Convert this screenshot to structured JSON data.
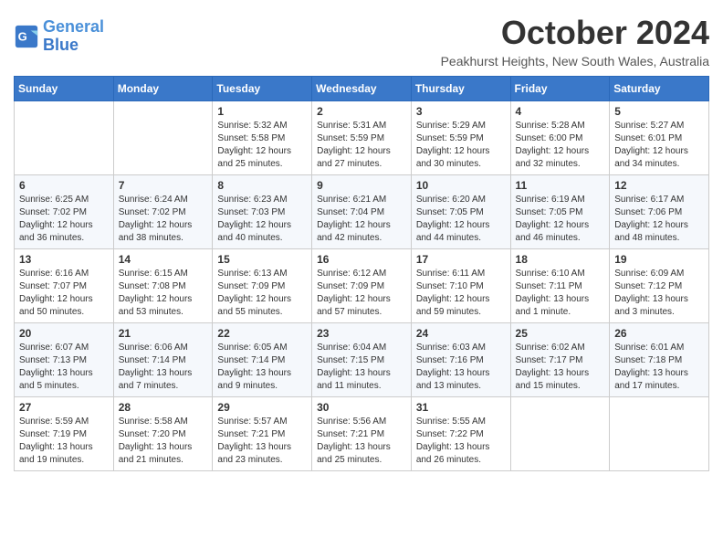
{
  "header": {
    "logo_line1": "General",
    "logo_line2": "Blue",
    "month": "October 2024",
    "location": "Peakhurst Heights, New South Wales, Australia"
  },
  "days_of_week": [
    "Sunday",
    "Monday",
    "Tuesday",
    "Wednesday",
    "Thursday",
    "Friday",
    "Saturday"
  ],
  "weeks": [
    [
      {
        "day": "",
        "empty": true
      },
      {
        "day": "",
        "empty": true
      },
      {
        "day": "1",
        "sunrise": "5:32 AM",
        "sunset": "5:58 PM",
        "daylight": "12 hours and 25 minutes."
      },
      {
        "day": "2",
        "sunrise": "5:31 AM",
        "sunset": "5:59 PM",
        "daylight": "12 hours and 27 minutes."
      },
      {
        "day": "3",
        "sunrise": "5:29 AM",
        "sunset": "5:59 PM",
        "daylight": "12 hours and 30 minutes."
      },
      {
        "day": "4",
        "sunrise": "5:28 AM",
        "sunset": "6:00 PM",
        "daylight": "12 hours and 32 minutes."
      },
      {
        "day": "5",
        "sunrise": "5:27 AM",
        "sunset": "6:01 PM",
        "daylight": "12 hours and 34 minutes."
      }
    ],
    [
      {
        "day": "6",
        "sunrise": "6:25 AM",
        "sunset": "7:02 PM",
        "daylight": "12 hours and 36 minutes."
      },
      {
        "day": "7",
        "sunrise": "6:24 AM",
        "sunset": "7:02 PM",
        "daylight": "12 hours and 38 minutes."
      },
      {
        "day": "8",
        "sunrise": "6:23 AM",
        "sunset": "7:03 PM",
        "daylight": "12 hours and 40 minutes."
      },
      {
        "day": "9",
        "sunrise": "6:21 AM",
        "sunset": "7:04 PM",
        "daylight": "12 hours and 42 minutes."
      },
      {
        "day": "10",
        "sunrise": "6:20 AM",
        "sunset": "7:05 PM",
        "daylight": "12 hours and 44 minutes."
      },
      {
        "day": "11",
        "sunrise": "6:19 AM",
        "sunset": "7:05 PM",
        "daylight": "12 hours and 46 minutes."
      },
      {
        "day": "12",
        "sunrise": "6:17 AM",
        "sunset": "7:06 PM",
        "daylight": "12 hours and 48 minutes."
      }
    ],
    [
      {
        "day": "13",
        "sunrise": "6:16 AM",
        "sunset": "7:07 PM",
        "daylight": "12 hours and 50 minutes."
      },
      {
        "day": "14",
        "sunrise": "6:15 AM",
        "sunset": "7:08 PM",
        "daylight": "12 hours and 53 minutes."
      },
      {
        "day": "15",
        "sunrise": "6:13 AM",
        "sunset": "7:09 PM",
        "daylight": "12 hours and 55 minutes."
      },
      {
        "day": "16",
        "sunrise": "6:12 AM",
        "sunset": "7:09 PM",
        "daylight": "12 hours and 57 minutes."
      },
      {
        "day": "17",
        "sunrise": "6:11 AM",
        "sunset": "7:10 PM",
        "daylight": "12 hours and 59 minutes."
      },
      {
        "day": "18",
        "sunrise": "6:10 AM",
        "sunset": "7:11 PM",
        "daylight": "13 hours and 1 minute."
      },
      {
        "day": "19",
        "sunrise": "6:09 AM",
        "sunset": "7:12 PM",
        "daylight": "13 hours and 3 minutes."
      }
    ],
    [
      {
        "day": "20",
        "sunrise": "6:07 AM",
        "sunset": "7:13 PM",
        "daylight": "13 hours and 5 minutes."
      },
      {
        "day": "21",
        "sunrise": "6:06 AM",
        "sunset": "7:14 PM",
        "daylight": "13 hours and 7 minutes."
      },
      {
        "day": "22",
        "sunrise": "6:05 AM",
        "sunset": "7:14 PM",
        "daylight": "13 hours and 9 minutes."
      },
      {
        "day": "23",
        "sunrise": "6:04 AM",
        "sunset": "7:15 PM",
        "daylight": "13 hours and 11 minutes."
      },
      {
        "day": "24",
        "sunrise": "6:03 AM",
        "sunset": "7:16 PM",
        "daylight": "13 hours and 13 minutes."
      },
      {
        "day": "25",
        "sunrise": "6:02 AM",
        "sunset": "7:17 PM",
        "daylight": "13 hours and 15 minutes."
      },
      {
        "day": "26",
        "sunrise": "6:01 AM",
        "sunset": "7:18 PM",
        "daylight": "13 hours and 17 minutes."
      }
    ],
    [
      {
        "day": "27",
        "sunrise": "5:59 AM",
        "sunset": "7:19 PM",
        "daylight": "13 hours and 19 minutes."
      },
      {
        "day": "28",
        "sunrise": "5:58 AM",
        "sunset": "7:20 PM",
        "daylight": "13 hours and 21 minutes."
      },
      {
        "day": "29",
        "sunrise": "5:57 AM",
        "sunset": "7:21 PM",
        "daylight": "13 hours and 23 minutes."
      },
      {
        "day": "30",
        "sunrise": "5:56 AM",
        "sunset": "7:21 PM",
        "daylight": "13 hours and 25 minutes."
      },
      {
        "day": "31",
        "sunrise": "5:55 AM",
        "sunset": "7:22 PM",
        "daylight": "13 hours and 26 minutes."
      },
      {
        "day": "",
        "empty": true
      },
      {
        "day": "",
        "empty": true
      }
    ]
  ],
  "labels": {
    "sunrise": "Sunrise:",
    "sunset": "Sunset:",
    "daylight": "Daylight:"
  }
}
